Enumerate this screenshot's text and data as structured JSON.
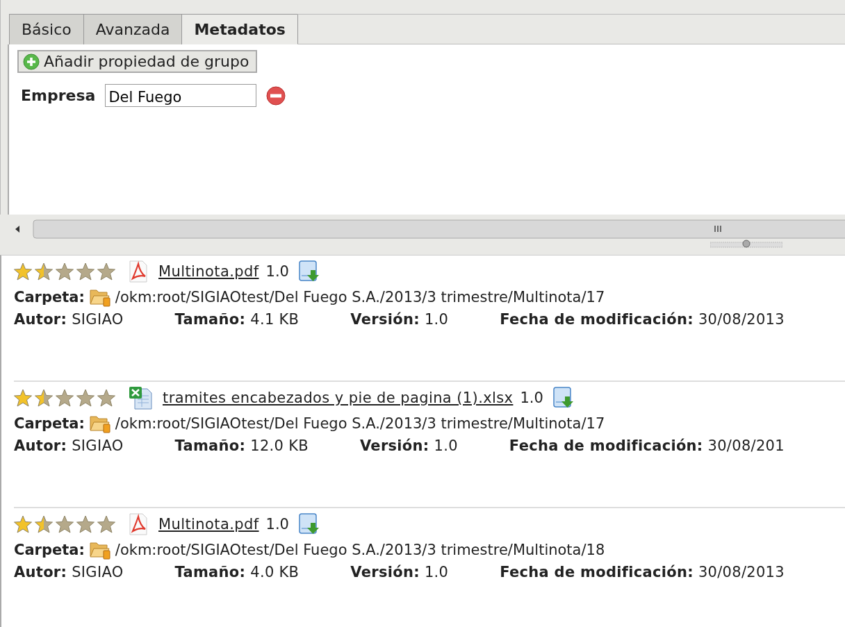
{
  "tabs": [
    {
      "label": "Básico",
      "selected": false
    },
    {
      "label": "Avanzada",
      "selected": false
    },
    {
      "label": "Metadatos",
      "selected": true
    }
  ],
  "metadata": {
    "add_button": "Añadir propiedad de grupo",
    "properties": [
      {
        "label": "Empresa",
        "value": "Del Fuego"
      }
    ]
  },
  "results": [
    {
      "stars": 1.5,
      "kind": "pdf",
      "name": "Multinota.pdf",
      "version": "1.0",
      "folder_label": "Carpeta:",
      "folder": "/okm:root/SIGIAOtest/Del Fuego S.A./2013/3 trimestre/Multinota/17",
      "author_label": "Autor:",
      "author": "SIGIAO",
      "size_label": "Tamaño:",
      "size": "4.1 KB",
      "version_label": "Versión:",
      "version_value": "1.0",
      "date_label": "Fecha de modificación:",
      "date": "30/08/2013"
    },
    {
      "stars": 1.5,
      "kind": "xlsx",
      "name": "tramites encabezados y pie de pagina (1).xlsx",
      "version": "1.0",
      "folder_label": "Carpeta:",
      "folder": "/okm:root/SIGIAOtest/Del Fuego S.A./2013/3 trimestre/Multinota/17",
      "author_label": "Autor:",
      "author": "SIGIAO",
      "size_label": "Tamaño:",
      "size": "12.0 KB",
      "version_label": "Versión:",
      "version_value": "1.0",
      "date_label": "Fecha de modificación:",
      "date": "30/08/201"
    },
    {
      "stars": 1.5,
      "kind": "pdf",
      "name": "Multinota.pdf",
      "version": "1.0",
      "folder_label": "Carpeta:",
      "folder": "/okm:root/SIGIAOtest/Del Fuego S.A./2013/3 trimestre/Multinota/18",
      "author_label": "Autor:",
      "author": "SIGIAO",
      "size_label": "Tamaño:",
      "size": "4.0 KB",
      "version_label": "Versión:",
      "version_value": "1.0",
      "date_label": "Fecha de modificación:",
      "date": "30/08/2013"
    }
  ]
}
